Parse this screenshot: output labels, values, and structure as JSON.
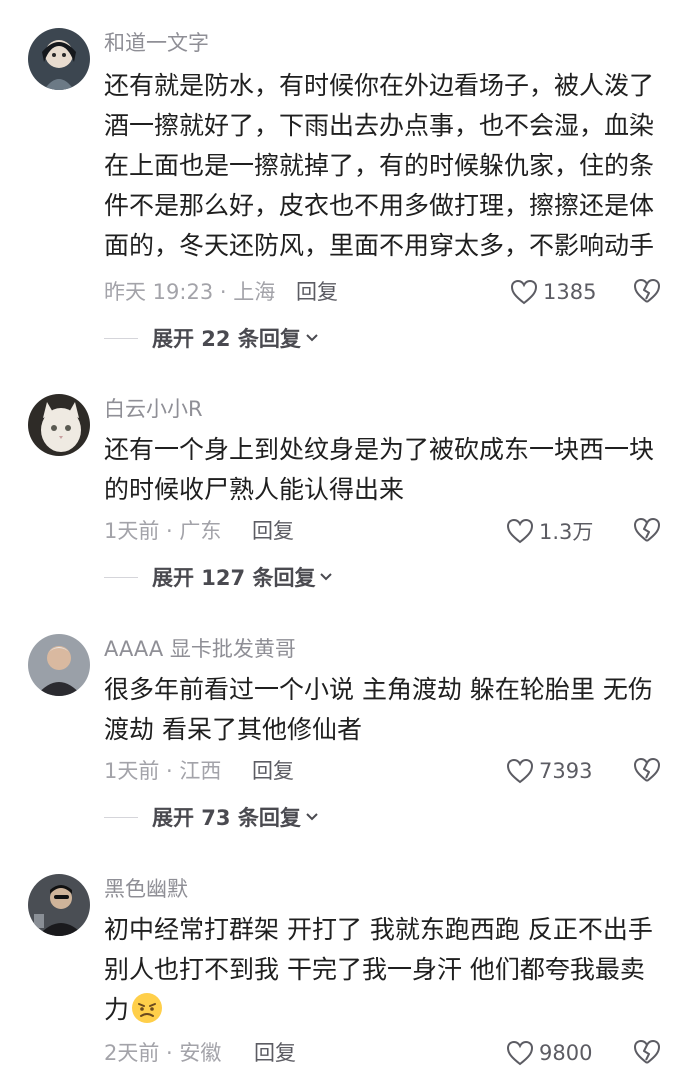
{
  "comments": [
    {
      "username": "和道一文字",
      "lines": [
        "还有就是防水，有时候你在外边看场子，被人泼了",
        "酒一擦就好了，下雨出去办点事，也不会湿，血染",
        "在上面也是一擦就掉了，有的时候躲仇家，住的条",
        "件不是那么好，皮衣也不用多做打理，擦擦还是体",
        "面的，冬天还防风，里面不用穿太多，不影响动手"
      ],
      "meta": "昨天 19:23 · 上海",
      "reply": "回复",
      "likes": "1385",
      "expand": "展开 22 条回复"
    },
    {
      "username": "白云小小R",
      "lines": [
        "还有一个身上到处纹身是为了被砍成东一块西一块",
        "的时候收尸熟人能认得出来"
      ],
      "meta": "1天前 · 广东",
      "reply": "回复",
      "likes": "1.3万",
      "expand": "展开 127 条回复"
    },
    {
      "username": "AAAA 显卡批发黄哥",
      "lines": [
        "很多年前看过一个小说 主角渡劫 躲在轮胎里 无伤",
        "渡劫 看呆了其他修仙者"
      ],
      "meta": "1天前 · 江西",
      "reply": "回复",
      "likes": "7393",
      "expand": "展开 73 条回复"
    },
    {
      "username": "黑色幽默",
      "lines": [
        "初中经常打群架 开打了 我就东跑西跑 反正不出手",
        "别人也打不到我 干完了我一身汗 他们都夸我最卖",
        "力"
      ],
      "meta": "2天前 · 安徽",
      "reply": "回复",
      "likes": "9800"
    }
  ],
  "icons": {
    "like": "heart-outline-icon",
    "dislike": "broken-heart-icon",
    "expand": "chevron-down-icon",
    "emoji": "frown-emoji-icon"
  },
  "colors": {
    "text": "#1f1f1f",
    "username": "#8f8f96",
    "meta": "#a3a3a9",
    "action": "#5c5c63"
  }
}
